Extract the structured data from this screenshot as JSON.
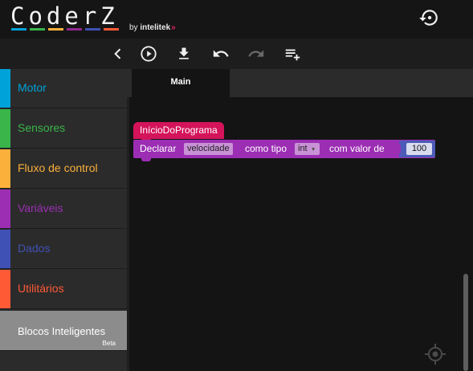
{
  "app": {
    "logo_text": "CoderZ",
    "logo_by": "by",
    "logo_brand": "intelitek",
    "logo_bar_colors": [
      "#00a3d9",
      "#39b54a",
      "#fbb03b",
      "#92278f",
      "#3f51b5",
      "#ff5a36"
    ]
  },
  "header": {
    "reset_icon": "history-reset-icon"
  },
  "toolbar": {
    "icons": [
      "chevron-left-icon",
      "play-icon",
      "download-icon",
      "undo-icon",
      "redo-icon",
      "playlist-add-icon"
    ]
  },
  "sidebar": {
    "categories": [
      {
        "label": "Motor",
        "color": "#00a3d9"
      },
      {
        "label": "Sensores",
        "color": "#39b54a"
      },
      {
        "label": "Fluxo de control",
        "color": "#fbb03b"
      },
      {
        "label": "Variáveis",
        "color": "#9b2eb3"
      },
      {
        "label": "Dados",
        "color": "#3f51b5"
      },
      {
        "label": "Utilitários",
        "color": "#ff5a36"
      }
    ],
    "smart_blocks": {
      "label": "Blocos Inteligentes",
      "badge": "Beta",
      "color": "#8c8c8c"
    }
  },
  "tabs": [
    {
      "label": "Main",
      "active": true
    }
  ],
  "workspace": {
    "start_block": {
      "label": "InícioDoPrograma",
      "color": "#d4145a"
    },
    "declare_block": {
      "color": "#9b2eb3",
      "text_declare": "Declarar",
      "var_name": "velocidade",
      "text_type": "como tipo",
      "type_value": "int",
      "text_value": "com valor de",
      "number_value": "100",
      "number_color": "#4c5bb8"
    },
    "center_icon": "crosshair-icon"
  }
}
